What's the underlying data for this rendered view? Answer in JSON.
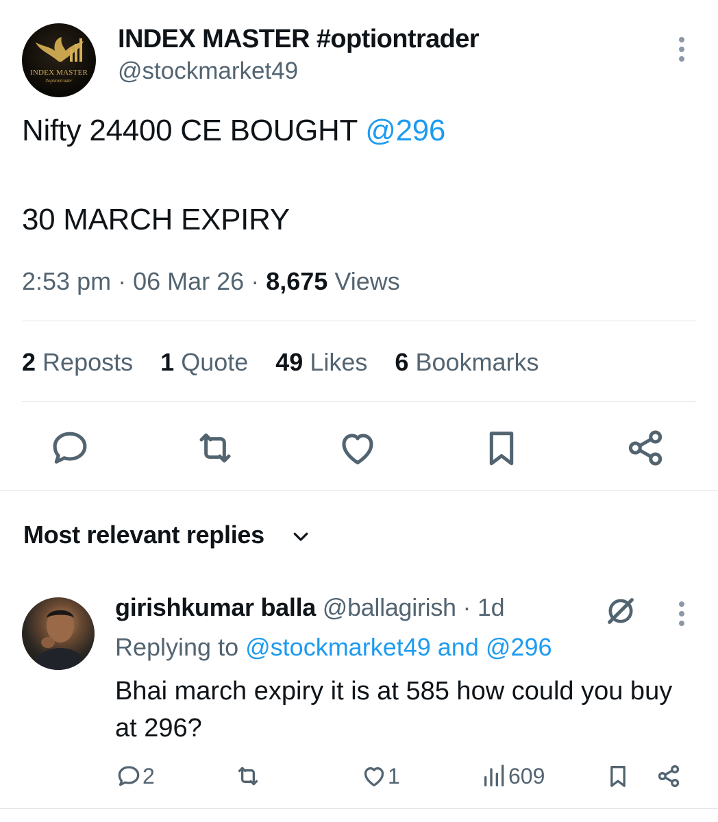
{
  "tweet": {
    "author_name": "INDEX MASTER #optiontrader",
    "author_handle": "@stockmarket49",
    "avatar_text_1": "INDEX MASTER",
    "avatar_text_2": "#optiontrader",
    "line1_text": "Nifty 24400 CE BOUGHT ",
    "line1_link": "@296",
    "line2_text": "30 MARCH EXPIRY",
    "time": "2:53 pm",
    "sep": "·",
    "date": "06 Mar 26",
    "views_count": "8,675",
    "views_label": "Views"
  },
  "stats": [
    {
      "count": "2",
      "label": "Reposts"
    },
    {
      "count": "1",
      "label": "Quote"
    },
    {
      "count": "49",
      "label": "Likes"
    },
    {
      "count": "6",
      "label": "Bookmarks"
    }
  ],
  "actions": [
    "reply-icon",
    "repost-icon",
    "like-icon",
    "bookmark-icon",
    "share-icon"
  ],
  "replies_header": "Most relevant replies",
  "reply": {
    "name": "girishkumar balla",
    "handle": "@ballagirish",
    "age": "· 1d",
    "replying_label": "Replying to",
    "replying_to_1": "@stockmarket49",
    "replying_and": "and",
    "replying_to_2": "@296",
    "text": "Bhai march expiry it is at 585 how could you buy at 296?",
    "reply_count": "2",
    "like_count": "1",
    "view_count": "609"
  },
  "colors": {
    "accent": "#1d9bf0",
    "text": "#0f1419",
    "muted": "#536471",
    "divider": "#e1e5e8"
  }
}
